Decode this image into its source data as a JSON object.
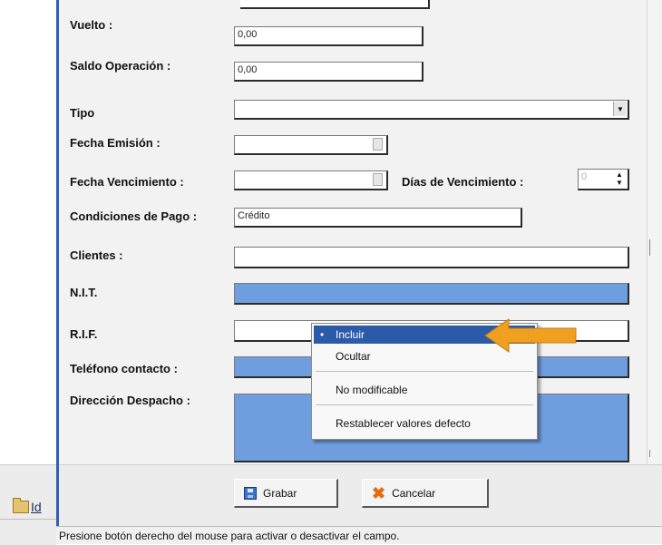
{
  "form": {
    "vuelto": {
      "label": "Vuelto :",
      "value": "0,00"
    },
    "saldo": {
      "label": "Saldo Operación :",
      "value": "0,00"
    },
    "tipo": {
      "label": "Tipo",
      "value": ""
    },
    "fecha_emision": {
      "label": "Fecha Emisión :",
      "value": ""
    },
    "fecha_vencimiento": {
      "label": "Fecha Vencimiento :",
      "value": ""
    },
    "dias_vencimiento": {
      "label": "Días de Vencimiento :",
      "value": "0"
    },
    "condiciones": {
      "label": "Condiciones de Pago :",
      "value": "Crédito"
    },
    "clientes": {
      "label": "Clientes  :",
      "value": ""
    },
    "nit": {
      "label": "N.I.T.",
      "value": ""
    },
    "rif": {
      "label": "R.I.F.",
      "value": ""
    },
    "telefono": {
      "label": "Teléfono contacto :",
      "value": ""
    },
    "direccion": {
      "label": "Dirección Despacho :",
      "value": ""
    }
  },
  "context_menu": {
    "items": [
      "Incluir",
      "Ocultar",
      "No modificable",
      "Restablecer valores defecto"
    ],
    "selected_index": 0,
    "bullet": "•"
  },
  "buttons": {
    "grabar": "Grabar",
    "cancelar": "Cancelar"
  },
  "left_toolbar": {
    "label": "Id"
  },
  "status_bar": "Presione botón derecho del mouse para activar o desactivar el campo.",
  "colors": {
    "field_blue": "#6f9ede",
    "menu_highlight": "#2a5aa8",
    "arrow": "#f0a020",
    "frame_line": "#2f5fb7"
  }
}
